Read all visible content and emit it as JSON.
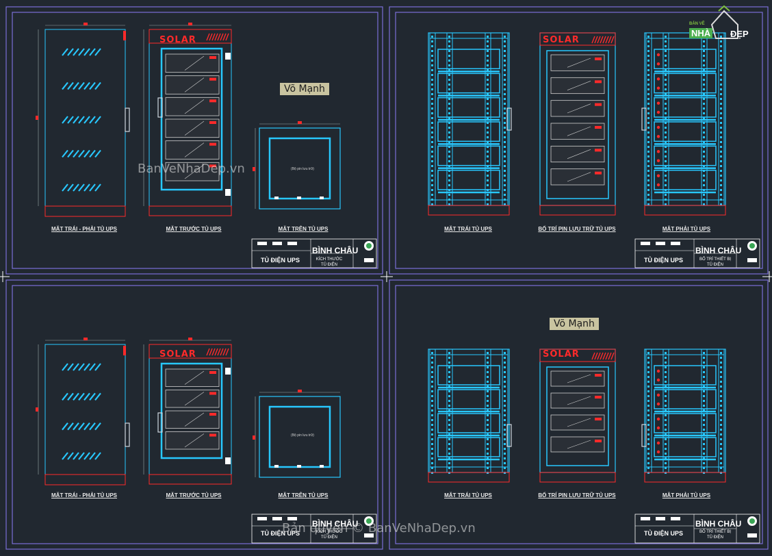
{
  "author_label": "Võ Mạnh",
  "brand_label": "SOLAR",
  "logo": {
    "top": "BẢN VẼ",
    "main": "NHÀ",
    "suffix": "ĐẸP"
  },
  "watermark_main": "BanVeNhaDep.vn",
  "watermark_copyright": "Bản quyền © BanVeNhaDep.vn",
  "storage_note": "(Bộ pin lưu trữ)",
  "colors": {
    "background": "#212830",
    "frame": "#7b6fd6",
    "cabinet": "#28c8ff",
    "red": "#ff2a2a",
    "white": "#ffffff"
  },
  "sheets": [
    {
      "captions": [
        "MẶT TRÁI - PHẢI TỦ UPS",
        "MẶT TRƯỚC TỦ UPS",
        "MẶT TRÊN TỦ UPS"
      ],
      "title_block": {
        "name": "TỦ ĐIỆN UPS",
        "company": "BÌNH CHÂU",
        "desc_line1": "KÍCH THƯỚC",
        "desc_line2": "TỦ ĐIỆN"
      }
    },
    {
      "captions": [
        "MẶT TRÁI TỦ UPS",
        "BỐ TRÍ PIN LƯU TRỮ TỦ UPS",
        "MẶT PHẢI TỦ UPS"
      ],
      "title_block": {
        "name": "TỦ ĐIỆN UPS",
        "company": "BÌNH CHÂU",
        "desc_line1": "BỐ TRÍ THIẾT BỊ",
        "desc_line2": "TỦ ĐIỆN"
      }
    },
    {
      "captions": [
        "MẶT TRÁI - PHẢI TỦ UPS",
        "MẶT TRƯỚC TỦ UPS",
        "MẶT TRÊN TỦ UPS"
      ],
      "title_block": {
        "name": "TỦ ĐIỆN UPS",
        "company": "BÌNH CHÂU",
        "desc_line1": "KÍCH THƯỚC",
        "desc_line2": "TỦ ĐIỆN"
      }
    },
    {
      "captions": [
        "MẶT TRÁI TỦ UPS",
        "BỐ TRÍ PIN LƯU TRỮ TỦ UPS",
        "MẶT PHẢI TỦ UPS"
      ],
      "title_block": {
        "name": "TỦ ĐIỆN UPS",
        "company": "BÌNH CHÂU",
        "desc_line1": "BỐ TRÍ THIẾT BỊ",
        "desc_line2": "TỦ ĐIỆN"
      }
    }
  ],
  "battery_counts": [
    6,
    6,
    4,
    4
  ]
}
